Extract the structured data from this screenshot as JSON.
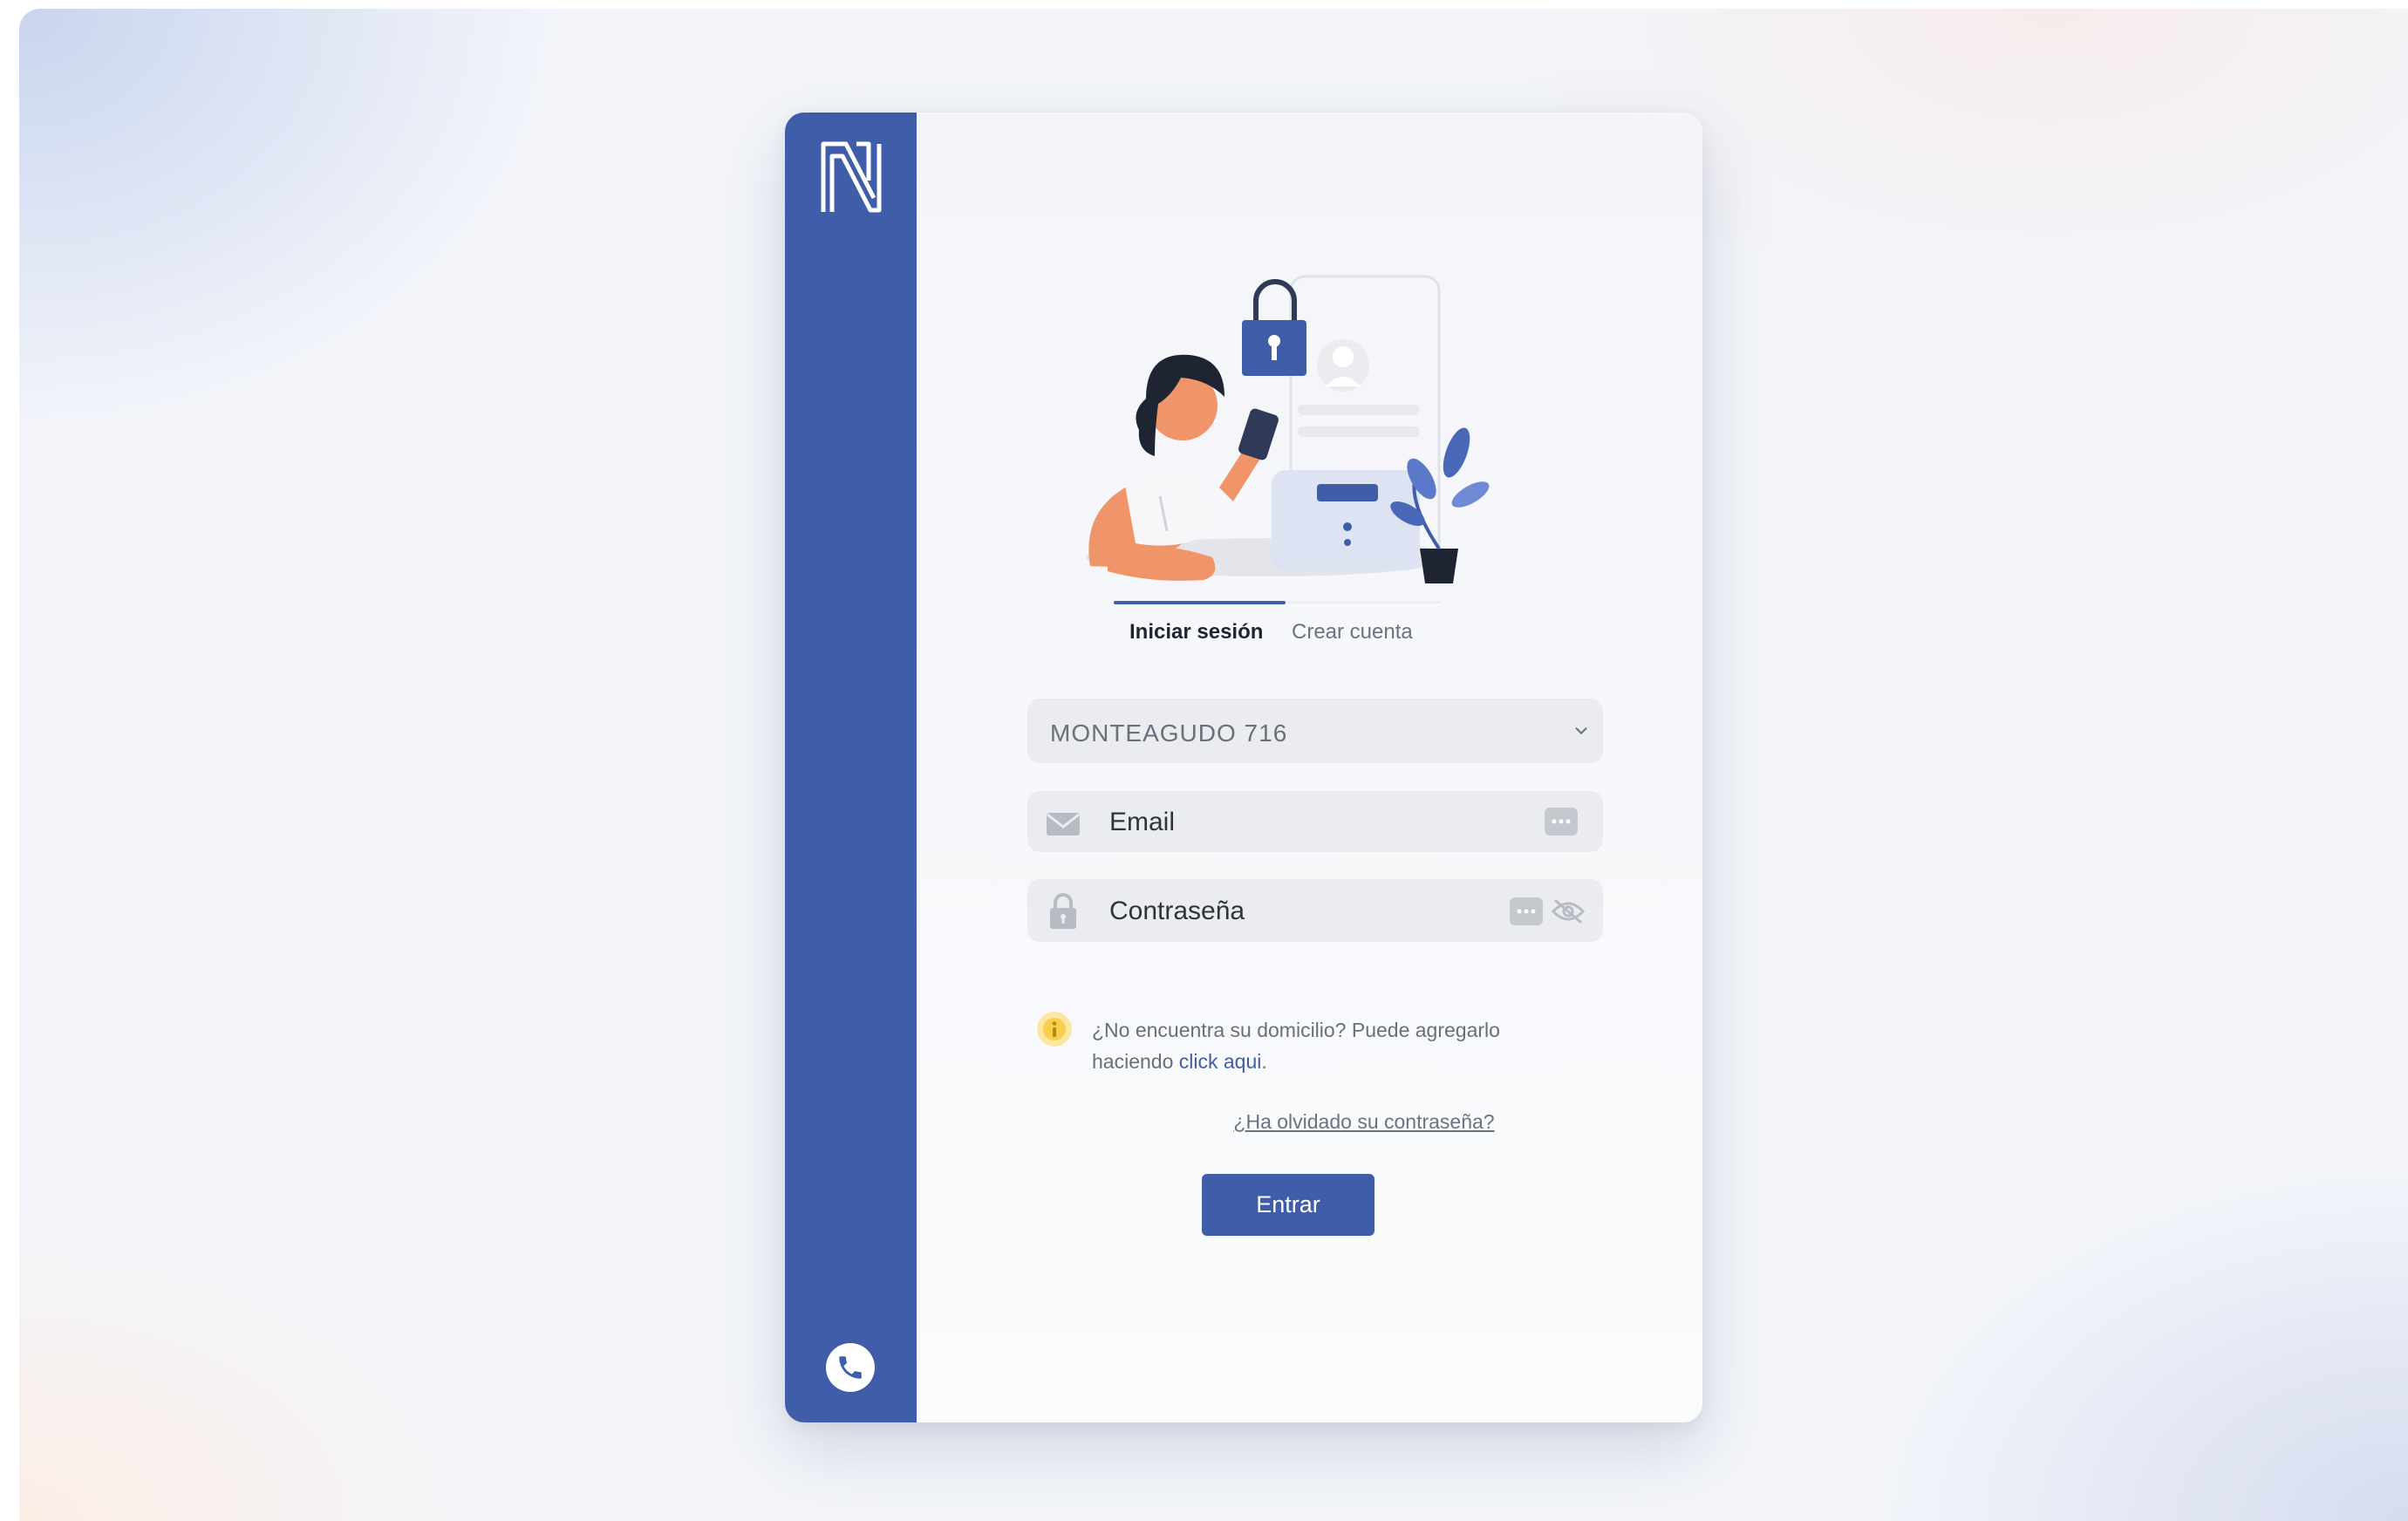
{
  "auth": {
    "tabs": [
      {
        "label": "Iniciar sesión",
        "active": true
      },
      {
        "label": "Crear cuenta",
        "active": false
      }
    ],
    "address_select": {
      "value": "MONTEAGUDO 716"
    },
    "email": {
      "placeholder": "Email"
    },
    "password": {
      "placeholder": "Contraseña"
    },
    "info": {
      "text": "¿No encuentra su domicilio? Puede agregarlo haciendo",
      "link_label": "click aqui"
    },
    "forgot_label": "¿Ha olvidado su contraseña?",
    "submit_label": "Entrar"
  },
  "icons": {
    "logo": "logo-n-icon",
    "phone": "phone-icon",
    "email": "envelope-icon",
    "password": "lock-icon",
    "keyboard": "keyboard-icon",
    "visibility": "eye-off-icon",
    "info": "info-icon",
    "select": "chevron-down-icon"
  },
  "colors": {
    "primary": "#3f5da9",
    "info_badge": "#f7cf4a",
    "field_bg": "#ebecf0"
  }
}
